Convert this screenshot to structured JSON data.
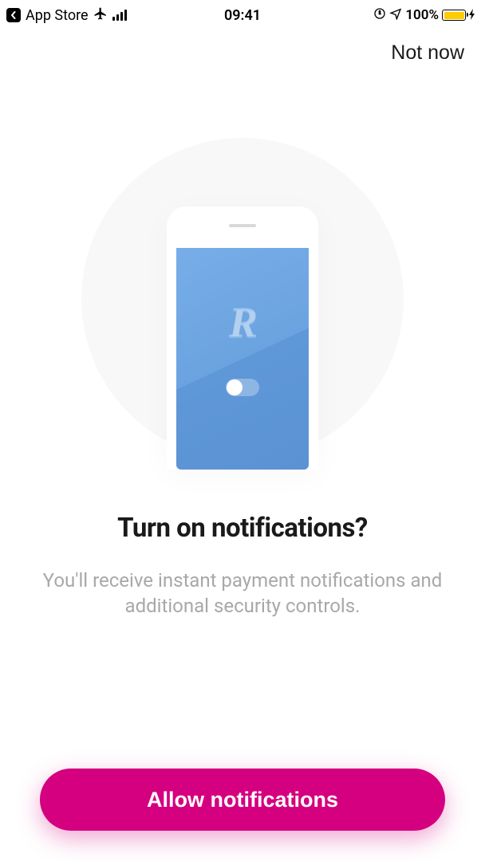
{
  "statusBar": {
    "backTarget": "App Store",
    "time": "09:41",
    "batteryPercent": "100%"
  },
  "nav": {
    "skip": "Not now"
  },
  "illustration": {
    "logoLetter": "R"
  },
  "content": {
    "heading": "Turn on notifications?",
    "body": "You'll receive instant payment notifications and additional security controls."
  },
  "cta": {
    "allow": "Allow notifications"
  },
  "colors": {
    "primary": "#d4007f",
    "phoneScreen": "#6ba3e0",
    "batteryFill": "#ffcc00"
  }
}
